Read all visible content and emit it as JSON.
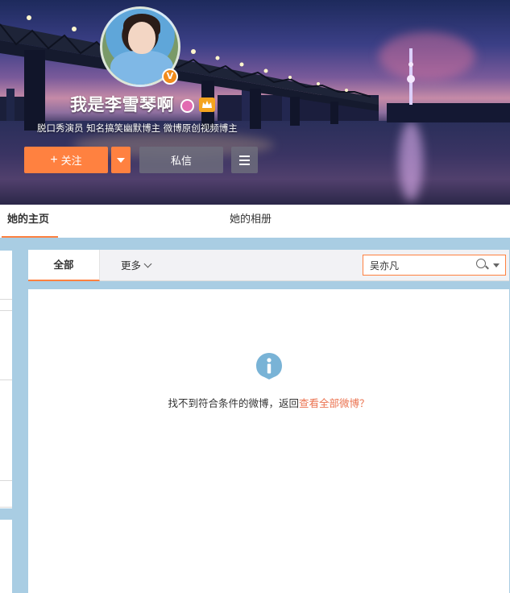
{
  "profile": {
    "name": "我是李雪琴啊",
    "bio": "脱口秀演员 知名搞笑幽默博主 微博原创视频博主",
    "verified_mark": "V"
  },
  "actions": {
    "follow_plus": "+",
    "follow_label": "关注",
    "message_label": "私信"
  },
  "tabs": {
    "home": "她的主页",
    "album": "她的相册"
  },
  "toolbar": {
    "all_label": "全部",
    "more_label": "更多"
  },
  "search": {
    "value": "吴亦凡"
  },
  "empty_state": {
    "message": "找不到符合条件的微博，返回",
    "link": "查看全部微博？"
  },
  "colors": {
    "accent": "#ff8140",
    "link": "#eb7350",
    "info_icon": "#79b3d6"
  }
}
